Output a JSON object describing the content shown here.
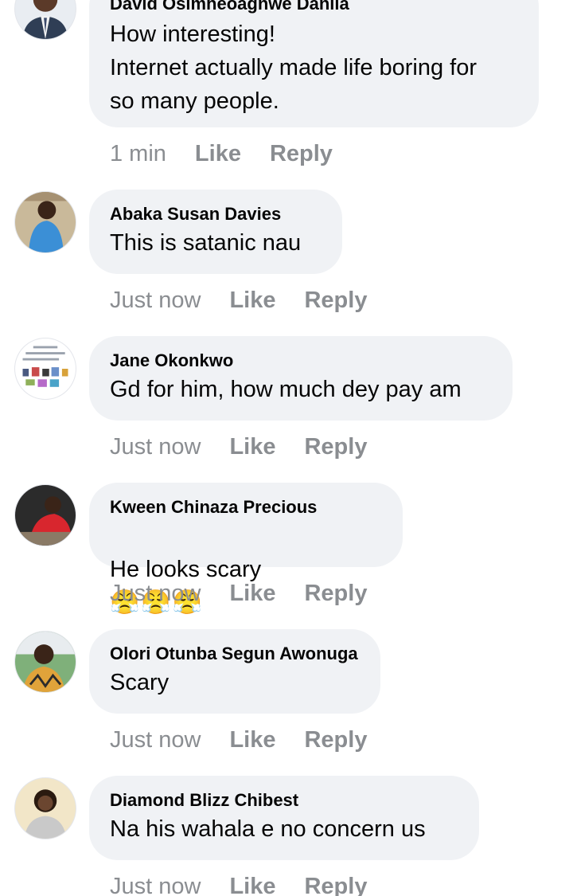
{
  "comments": [
    {
      "author": "David Osimheoagnwe Danila",
      "text": "How interesting!\nInternet actually made life boring for\nso many people.",
      "time": "1 min",
      "like_label": "Like",
      "reply_label": "Reply",
      "avatar_icon": "profile-photo-man-in-suit"
    },
    {
      "author": "Abaka Susan Davies",
      "text": "This is satanic nau",
      "time": "Just now",
      "like_label": "Like",
      "reply_label": "Reply",
      "avatar_icon": "profile-photo-blue-shirt"
    },
    {
      "author": "Jane Okonkwo",
      "text": "Gd for him, how much dey pay am",
      "time": "Just now",
      "like_label": "Like",
      "reply_label": "Reply",
      "avatar_icon": "profile-photo-product-flyer"
    },
    {
      "author": "Kween Chinaza Precious",
      "text": "He looks scary",
      "emoji": "😤😤😤",
      "time": "Just now",
      "like_label": "Like",
      "reply_label": "Reply",
      "avatar_icon": "profile-photo-red-outfit"
    },
    {
      "author": "Olori Otunba Segun Awonuga",
      "text": "Scary",
      "time": "Just now",
      "like_label": "Like",
      "reply_label": "Reply",
      "avatar_icon": "profile-photo-woman-outdoors"
    },
    {
      "author": "Diamond Blizz Chibest",
      "text": "Na his wahala e no concern us",
      "time": "Just now",
      "like_label": "Like",
      "reply_label": "Reply",
      "avatar_icon": "profile-photo-woman-smiling"
    }
  ],
  "colors": {
    "bubble": "#f0f2f5",
    "text": "#050505",
    "meta": "#8a8d91"
  }
}
